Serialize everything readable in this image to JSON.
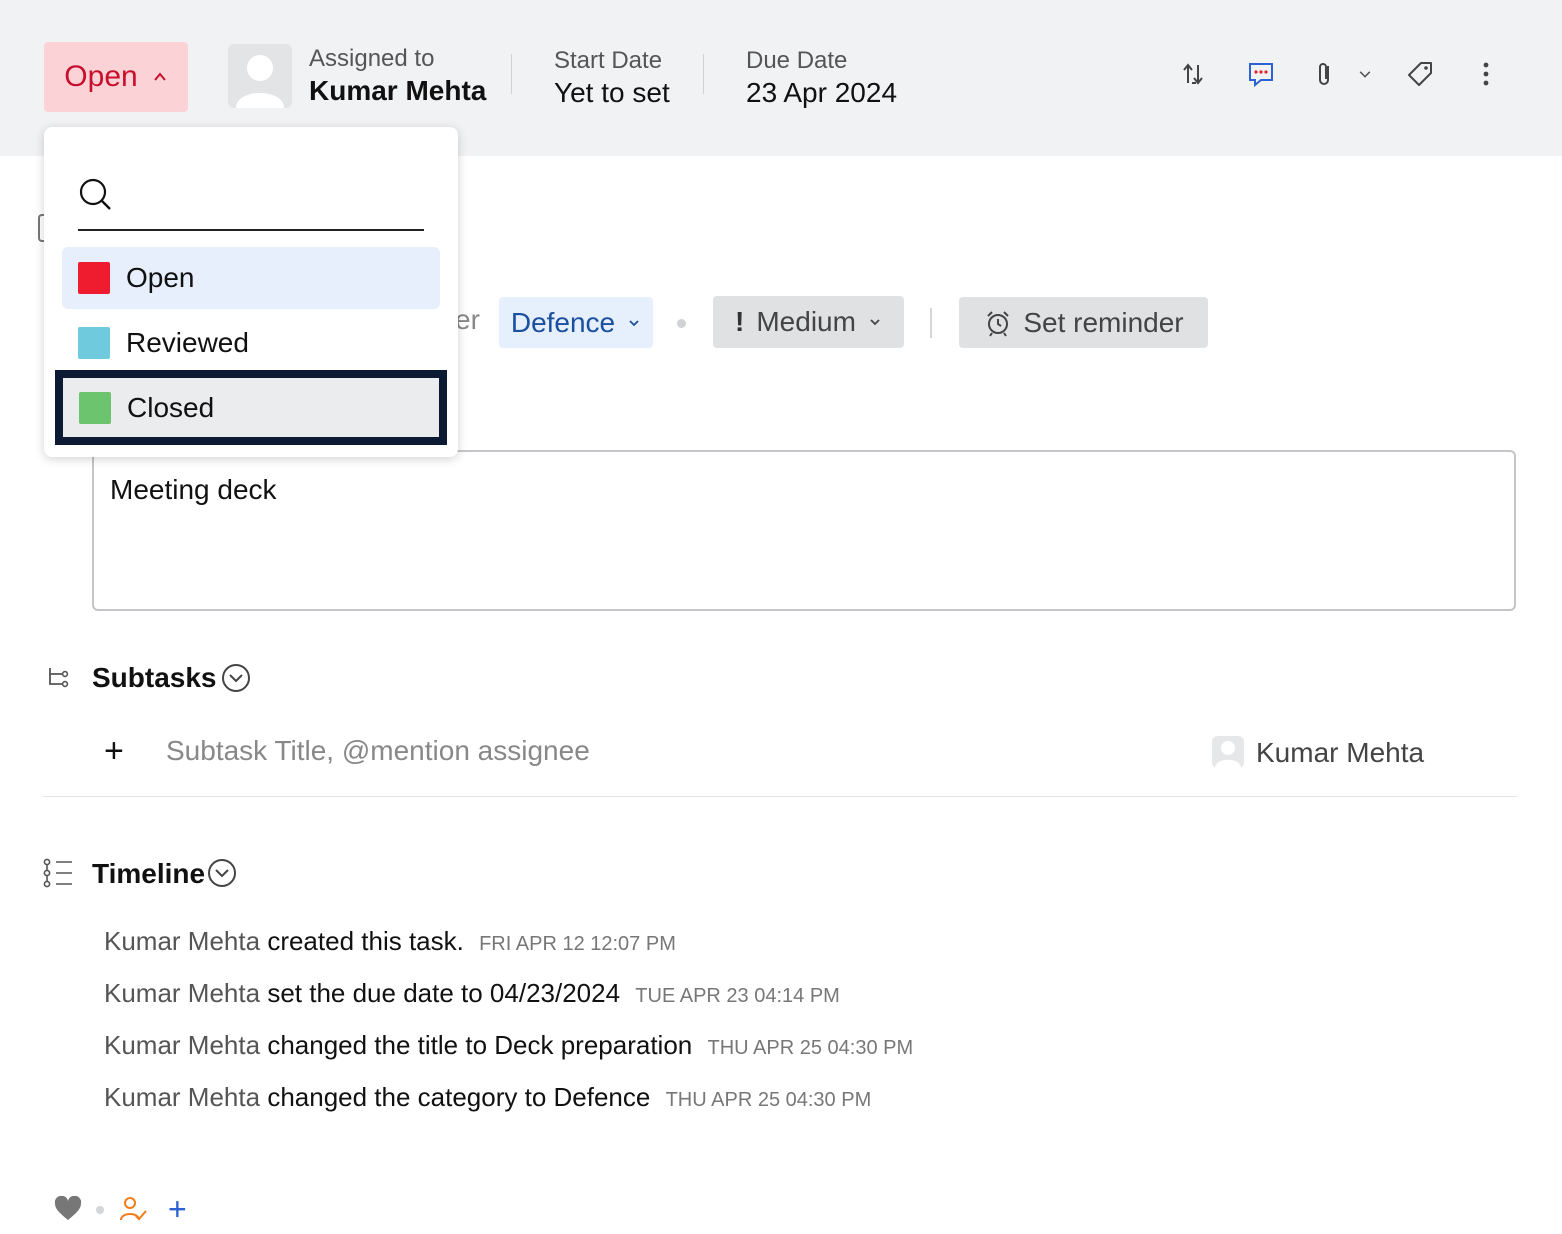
{
  "header": {
    "status": {
      "label": "Open",
      "color": "#c8102e",
      "bg": "#fbd3d6"
    },
    "assigned": {
      "label": "Assigned to",
      "value": "Kumar Mehta"
    },
    "start_date": {
      "label": "Start Date",
      "value": "Yet to set"
    },
    "due_date": {
      "label": "Due Date",
      "value": "23 Apr 2024"
    },
    "icons": [
      "transition-icon",
      "comment-icon",
      "attachment-icon",
      "chevron-down-icon",
      "tag-icon",
      "more-icon"
    ]
  },
  "status_dropdown": {
    "search": {
      "placeholder": ""
    },
    "options": [
      {
        "label": "Open",
        "color": "#ee1c2e",
        "state": "selected"
      },
      {
        "label": "Reviewed",
        "color": "#6fcadd",
        "state": "normal"
      },
      {
        "label": "Closed",
        "color": "#6cc46f",
        "state": "focused"
      }
    ]
  },
  "tags": {
    "partial_text": "er",
    "category": "Defence",
    "priority": "Medium",
    "priority_mark": "!",
    "reminder": "Set reminder"
  },
  "description": {
    "value": "Meeting deck"
  },
  "subtasks": {
    "title": "Subtasks",
    "add_symbol": "+",
    "input_placeholder": "Subtask Title, @mention assignee",
    "assignee": "Kumar Mehta"
  },
  "timeline": {
    "title": "Timeline",
    "entries": [
      {
        "who": "Kumar Mehta",
        "action": "created this task.",
        "time": "FRI APR 12 12:07 PM"
      },
      {
        "who": "Kumar Mehta",
        "action": "set the due date to 04/23/2024",
        "time": "TUE APR 23 04:14 PM"
      },
      {
        "who": "Kumar Mehta",
        "action": "changed the title to Deck preparation",
        "time": "THU APR 25 04:30 PM"
      },
      {
        "who": "Kumar Mehta",
        "action": "changed the category to Defence",
        "time": "THU APR 25 04:30 PM"
      }
    ]
  },
  "footer": {
    "add_symbol": "+"
  }
}
